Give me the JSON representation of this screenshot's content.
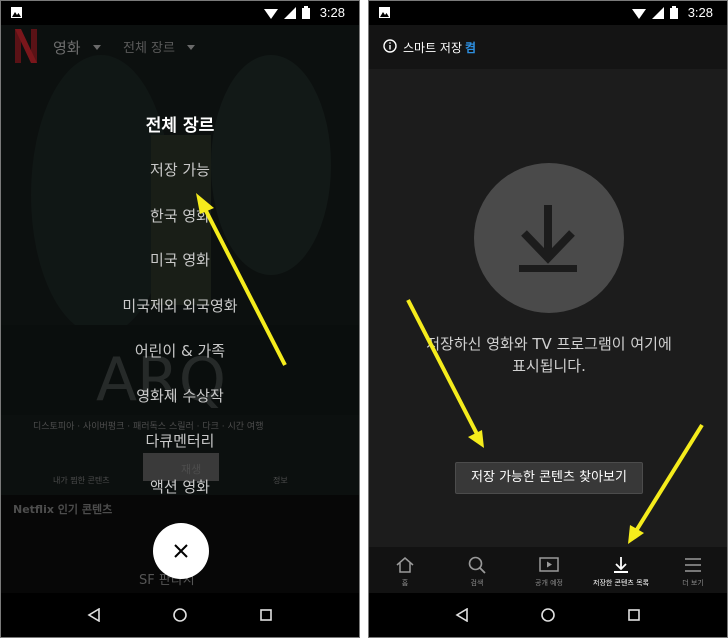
{
  "status_bar": {
    "time": "3:28"
  },
  "left_screen": {
    "brand_logo_letter": "N",
    "topbar": {
      "movies_label": "영화",
      "genre_label": "전체 장르"
    },
    "background": {
      "hero_title": "ARQ",
      "tags": "디스토피아 · 사이버펑크 · 패러독스 스릴러 · 다크 · 시간 여행",
      "my_list_label": "내가 찜한 콘텐츠",
      "play_label": "재생",
      "info_label": "정보",
      "popular_row": "Netflix 인기 콘텐츠",
      "bottom_peek": "SF 판타지"
    },
    "genre_menu": {
      "heading": "전체 장르",
      "items": [
        "저장 가능",
        "한국 영화",
        "미국 영화",
        "미국제외 외국영화",
        "어린이 & 가족",
        "영화제 수상작",
        "다큐멘터리",
        "액션 영화"
      ]
    }
  },
  "right_screen": {
    "smart_download": {
      "label": "스마트 저장",
      "state": "켬"
    },
    "empty_message_line1": "저장하신 영화와 TV 프로그램이 여기에",
    "empty_message_line2": "표시됩니다.",
    "find_button": "저장 가능한 콘텐츠 찾아보기",
    "tabs": [
      {
        "label": "홈",
        "icon": "home-icon",
        "active": false
      },
      {
        "label": "검색",
        "icon": "search-icon",
        "active": false
      },
      {
        "label": "공개 예정",
        "icon": "coming-soon-icon",
        "active": false
      },
      {
        "label": "저장한 콘텐츠 목록",
        "icon": "download-icon",
        "active": true
      },
      {
        "label": "더 보기",
        "icon": "menu-icon",
        "active": false
      }
    ]
  },
  "colors": {
    "annotation_arrow": "#f5ec1c",
    "smart_on": "#2d8fe0",
    "brand_red": "#b20710"
  }
}
